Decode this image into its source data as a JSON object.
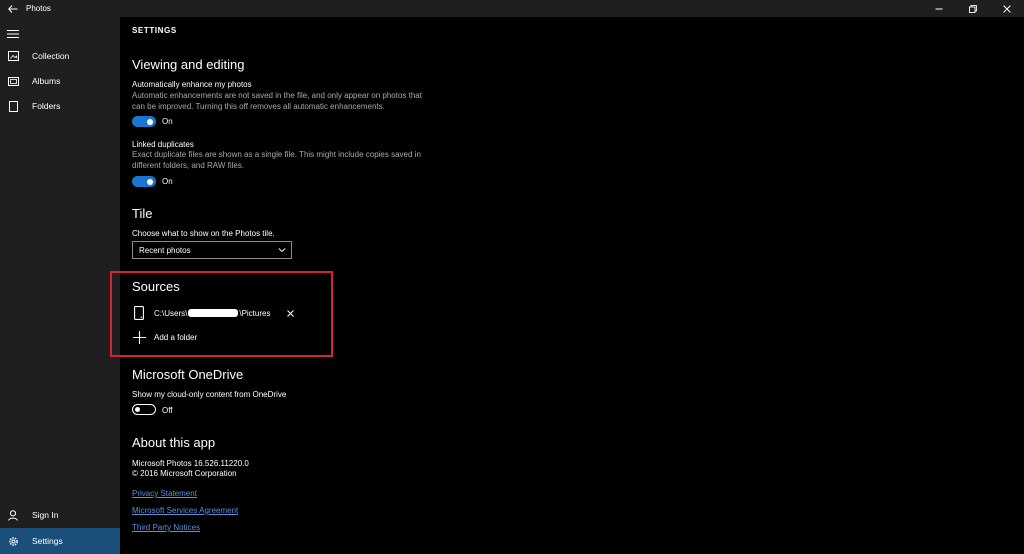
{
  "window": {
    "title": "Photos",
    "back_icon": "back-arrow-icon",
    "controls": [
      "minimize-icon",
      "restore-icon",
      "close-icon"
    ]
  },
  "sidebar": {
    "menu_icon": "hamburger-icon",
    "items": [
      {
        "label": "Collection",
        "icon": "collection-icon"
      },
      {
        "label": "Albums",
        "icon": "albums-icon"
      },
      {
        "label": "Folders",
        "icon": "folders-icon"
      }
    ],
    "bottom_items": [
      {
        "label": "Sign In",
        "icon": "person-icon"
      },
      {
        "label": "Settings",
        "icon": "gear-icon",
        "active": true
      }
    ],
    "active_color": "#1a4f7a"
  },
  "settings": {
    "header": "SETTINGS",
    "viewing": {
      "title": "Viewing and editing",
      "enhance": {
        "label": "Automatically enhance my photos",
        "desc": "Automatic enhancements are not saved in the file, and only appear on photos that can be improved. Turning this off removes all automatic enhancements.",
        "state": "On"
      },
      "duplicates": {
        "label": "Linked duplicates",
        "desc": "Exact duplicate files are shown as a single file. This might include copies saved in different folders, and RAW files.",
        "state": "On"
      }
    },
    "tile": {
      "title": "Tile",
      "label": "Choose what to show on the Photos tile.",
      "selected": "Recent photos"
    },
    "sources": {
      "title": "Sources",
      "folder_prefix": "C:\\Users\\",
      "folder_suffix": "\\Pictures",
      "add_label": "Add a folder"
    },
    "onedrive": {
      "title": "Microsoft OneDrive",
      "label": "Show my cloud-only content from OneDrive",
      "state": "Off"
    },
    "about": {
      "title": "About this app",
      "version": "Microsoft Photos 16.526.11220.0",
      "copyright": "© 2016 Microsoft Corporation",
      "links": [
        "Privacy Statement",
        "Microsoft Services Agreement",
        "Third Party Notices"
      ]
    }
  },
  "colors": {
    "accent": "#1b75d0",
    "highlight_border": "#d3262f",
    "link": "#5a8fd8"
  }
}
